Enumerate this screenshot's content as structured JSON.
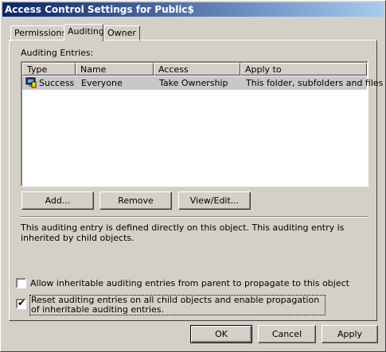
{
  "window": {
    "title": "Access Control Settings for Public$"
  },
  "tabs": [
    {
      "label": "Permissions",
      "active": false
    },
    {
      "label": "Auditing",
      "active": true
    },
    {
      "label": "Owner",
      "active": false
    }
  ],
  "auditing": {
    "entries_label": "Auditing Entries:",
    "columns": [
      "Type",
      "Name",
      "Access",
      "Apply to"
    ],
    "rows": [
      {
        "type": "Success",
        "name": "Everyone",
        "access": "Take Ownership",
        "apply_to": "This folder, subfolders and files",
        "icon": "audit-entry-icon"
      }
    ],
    "buttons": {
      "add": "Add...",
      "remove": "Remove",
      "view_edit": "View/Edit..."
    },
    "description": "This auditing entry is defined directly on this object. This auditing entry is inherited by child objects.",
    "options": [
      {
        "label": "Allow inheritable auditing entries from parent to propagate to this object",
        "checked": false
      },
      {
        "label": "Reset auditing entries on all child objects and enable propagation of inheritable auditing entries.",
        "checked": true
      }
    ]
  },
  "footer": {
    "ok": "OK",
    "cancel": "Cancel",
    "apply": "Apply"
  },
  "colors": {
    "titlebar": "#0a246a",
    "face": "#d4d0c8",
    "selected_row": "#c8c8c8"
  }
}
